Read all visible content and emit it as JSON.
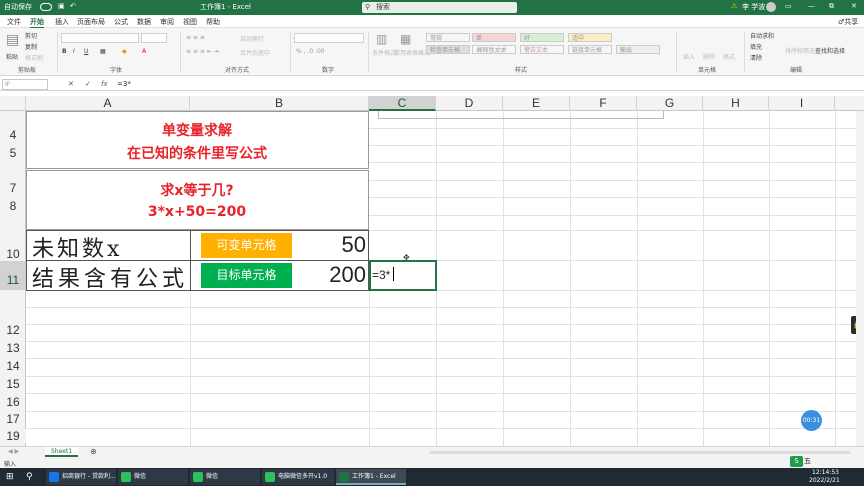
{
  "titlebar": {
    "autosave": "自动保存",
    "title": "工作簿1 - Excel",
    "search_placeholder": "搜索",
    "warning": "⚠",
    "user": "李 学波",
    "min": "—",
    "restore": "⧉",
    "close": "✕",
    "qa_icon": "↶"
  },
  "tabs": [
    "文件",
    "开始",
    "插入",
    "页面布局",
    "公式",
    "数据",
    "审阅",
    "视图",
    "帮助"
  ],
  "active_tab": "开始",
  "share": "♂共享",
  "ribbon": {
    "groups": [
      "剪贴板",
      "字体",
      "对齐方式",
      "数字",
      "样式",
      "单元格",
      "编辑"
    ],
    "clipboard": {
      "paste": "粘贴",
      "cut": "剪切",
      "copy": "复制",
      "format_painter": "格式刷"
    },
    "font": {
      "bold": "B",
      "italic": "I",
      "underline": "U",
      "grow": "A",
      "shrink": "A"
    },
    "align": {
      "wrap": "自动换行",
      "merge": "合并后居中"
    },
    "styles": {
      "cond": "条件格式",
      "table": "套用表格格式",
      "cells": [
        "常规",
        "差",
        "好",
        "适中",
        "检查单元格",
        "解释性文本",
        "警告文本",
        "链接单元格",
        "输出"
      ]
    },
    "cells": {
      "insert": "插入",
      "delete": "删除",
      "format": "格式"
    },
    "editing": {
      "autosum": "自动求和",
      "fill": "填充",
      "clear": "清除",
      "sort": "排序和筛选",
      "find": "查找和选择"
    }
  },
  "formula_bar": {
    "namebox": "IF",
    "cancel": "✕",
    "enter": "✓",
    "fx": "fx",
    "content": "=3*"
  },
  "columns": [
    "A",
    "B",
    "C",
    "D",
    "E",
    "F",
    "G",
    "H",
    "I"
  ],
  "rows": [
    "4",
    "5",
    "7",
    "8",
    "10",
    "11",
    "12",
    "13",
    "14",
    "15",
    "16",
    "17",
    "18",
    "19"
  ],
  "cells": {
    "title1": "单变量求解",
    "title2": "在已知的条件里写公式",
    "q1": "求x等于几?",
    "q2": "3*x+50=200",
    "a10": "未知数x",
    "b10_label": "可变单元格",
    "b10_value": "50",
    "a11": "结果含有公式",
    "b11_label": "目标单元格",
    "b11_value": "200",
    "c11": "=3*"
  },
  "sheet_tab": "Sheet1",
  "add_sheet": "⊕",
  "status_mode": "输入",
  "timer": "00:31",
  "side_icon": "🔒",
  "ime": "五",
  "clock": {
    "time": "12:14:53",
    "date": "2022/2/21"
  },
  "taskbar": {
    "start": "⊞",
    "search": "⚲",
    "items": [
      "招商银行 - 贷款利...",
      "微信",
      "微信",
      "电脑微信多开v1.0",
      "工作簿1 - Excel"
    ]
  },
  "colors": {
    "excel_green": "#217346",
    "red_text": "#e8232a",
    "orange": "#ffb000",
    "green_cell": "#00b050"
  }
}
